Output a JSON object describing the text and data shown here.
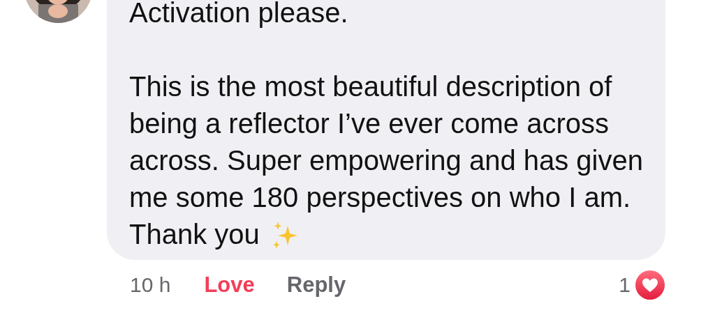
{
  "comment": {
    "paragraphs": [
      "Activation please.",
      "This is the most beautiful description of\nbeing a reflector I’ve ever come across\nacross. Super empowering and has given\nme some 180 perspectives on who I am.\nThank you"
    ],
    "time": "10 h",
    "actions": [
      {
        "label": "Love",
        "selected": true
      },
      {
        "label": "Reply",
        "selected": false
      }
    ],
    "reaction_count": "1"
  }
}
